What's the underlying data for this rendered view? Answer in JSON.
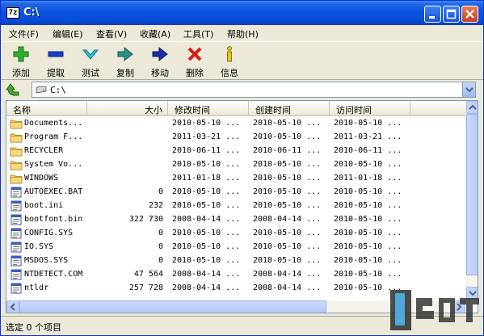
{
  "window": {
    "title": "C:\\",
    "app_badge": "7z"
  },
  "menu": [
    "文件(F)",
    "编辑(E)",
    "查看(V)",
    "收藏(A)",
    "工具(T)",
    "帮助(H)"
  ],
  "toolbar": [
    {
      "label": "添加",
      "icon": "plus-icon"
    },
    {
      "label": "提取",
      "icon": "minus-icon"
    },
    {
      "label": "测试",
      "icon": "check-icon"
    },
    {
      "label": "复制",
      "icon": "copy-arrow-icon"
    },
    {
      "label": "移动",
      "icon": "move-arrow-icon"
    },
    {
      "label": "删除",
      "icon": "delete-x-icon"
    },
    {
      "label": "信息",
      "icon": "info-icon"
    }
  ],
  "address": {
    "path": "C:\\"
  },
  "columns": {
    "name": "名称",
    "size": "大小",
    "modified": "修改时间",
    "created": "创建时间",
    "accessed": "访问时间"
  },
  "files": [
    {
      "name": "Documents...",
      "type": "folder",
      "size": "",
      "modified": "2010-05-10 ...",
      "created": "2010-05-10 ...",
      "accessed": "2010-05-10 ..."
    },
    {
      "name": "Program F...",
      "type": "folder",
      "size": "",
      "modified": "2011-03-21 ...",
      "created": "2010-05-10 ...",
      "accessed": "2011-03-21 ..."
    },
    {
      "name": "RECYCLER",
      "type": "folder",
      "size": "",
      "modified": "2010-06-11 ...",
      "created": "2010-06-11 ...",
      "accessed": "2010-06-11 ..."
    },
    {
      "name": "System Vo...",
      "type": "folder",
      "size": "",
      "modified": "2010-05-10 ...",
      "created": "2010-05-10 ...",
      "accessed": "2010-05-10 ..."
    },
    {
      "name": "WINDOWS",
      "type": "folder",
      "size": "",
      "modified": "2011-01-18 ...",
      "created": "2010-05-10 ...",
      "accessed": "2011-01-18 ..."
    },
    {
      "name": "AUTOEXEC.BAT",
      "type": "file",
      "size": "0",
      "modified": "2010-05-10 ...",
      "created": "2010-05-10 ...",
      "accessed": "2010-05-10 ..."
    },
    {
      "name": "boot.ini",
      "type": "file",
      "size": "232",
      "modified": "2010-05-10 ...",
      "created": "2010-05-10 ...",
      "accessed": "2010-05-10 ..."
    },
    {
      "name": "bootfont.bin",
      "type": "file",
      "size": "322 730",
      "modified": "2008-04-14 ...",
      "created": "2008-04-14 ...",
      "accessed": "2010-05-10 ..."
    },
    {
      "name": "CONFIG.SYS",
      "type": "file",
      "size": "0",
      "modified": "2010-05-10 ...",
      "created": "2010-05-10 ...",
      "accessed": "2010-05-10 ..."
    },
    {
      "name": "IO.SYS",
      "type": "file",
      "size": "0",
      "modified": "2010-05-10 ...",
      "created": "2010-05-10 ...",
      "accessed": "2010-05-10 ..."
    },
    {
      "name": "MSDOS.SYS",
      "type": "file",
      "size": "0",
      "modified": "2010-05-10 ...",
      "created": "2010-05-10 ...",
      "accessed": "2010-05-10 ..."
    },
    {
      "name": "NTDETECT.COM",
      "type": "file",
      "size": "47 564",
      "modified": "2008-04-14 ...",
      "created": "2008-04-14 ...",
      "accessed": "2010-05-10 ..."
    },
    {
      "name": "ntldr",
      "type": "file",
      "size": "257 728",
      "modified": "2008-04-14 ...",
      "created": "2008-04-14 ...",
      "accessed": "2010-05-10 ..."
    }
  ],
  "status": {
    "text": "选定 0 个项目"
  },
  "colors": {
    "title_bar": "#0A54E3",
    "window_bg": "#ECE9D8",
    "folder": "#F2CE63"
  }
}
